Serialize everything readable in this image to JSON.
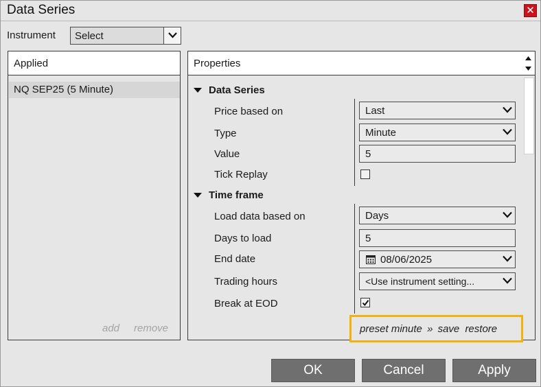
{
  "window": {
    "title": "Data Series"
  },
  "instrument": {
    "label": "Instrument",
    "value": "Select"
  },
  "applied": {
    "header": "Applied",
    "items": [
      "NQ SEP25 (5 Minute)"
    ],
    "add_label": "add",
    "remove_label": "remove"
  },
  "properties": {
    "header": "Properties",
    "sections": [
      {
        "title": "Data Series",
        "rows": [
          {
            "label": "Price based on",
            "value": "Last",
            "kind": "dropdown"
          },
          {
            "label": "Type",
            "value": "Minute",
            "kind": "dropdown"
          },
          {
            "label": "Value",
            "value": "5",
            "kind": "text"
          },
          {
            "label": "Tick Replay",
            "checked": false,
            "kind": "checkbox"
          }
        ]
      },
      {
        "title": "Time frame",
        "rows": [
          {
            "label": "Load data based on",
            "value": "Days",
            "kind": "dropdown"
          },
          {
            "label": "Days to load",
            "value": "5",
            "kind": "text"
          },
          {
            "label": "End date",
            "value": "08/06/2025",
            "kind": "date"
          },
          {
            "label": "Trading hours",
            "value": "<Use instrument setting...",
            "kind": "dropdown"
          },
          {
            "label": "Break at EOD",
            "checked": true,
            "kind": "checkbox"
          }
        ]
      }
    ],
    "preset": {
      "preset_label": "preset minute",
      "separator": "»",
      "save_label": "save",
      "restore_label": "restore"
    }
  },
  "buttons": {
    "ok": "OK",
    "cancel": "Cancel",
    "apply": "Apply"
  },
  "colors": {
    "accent_highlight": "#f2b10c",
    "close_button": "#c8141e",
    "button_bg": "#6f6f6f"
  },
  "icons": [
    "close-icon",
    "chevron-down-icon",
    "triangle-down-icon",
    "calendar-icon",
    "checkmark-icon",
    "scroll-up-icon",
    "scroll-down-icon"
  ]
}
